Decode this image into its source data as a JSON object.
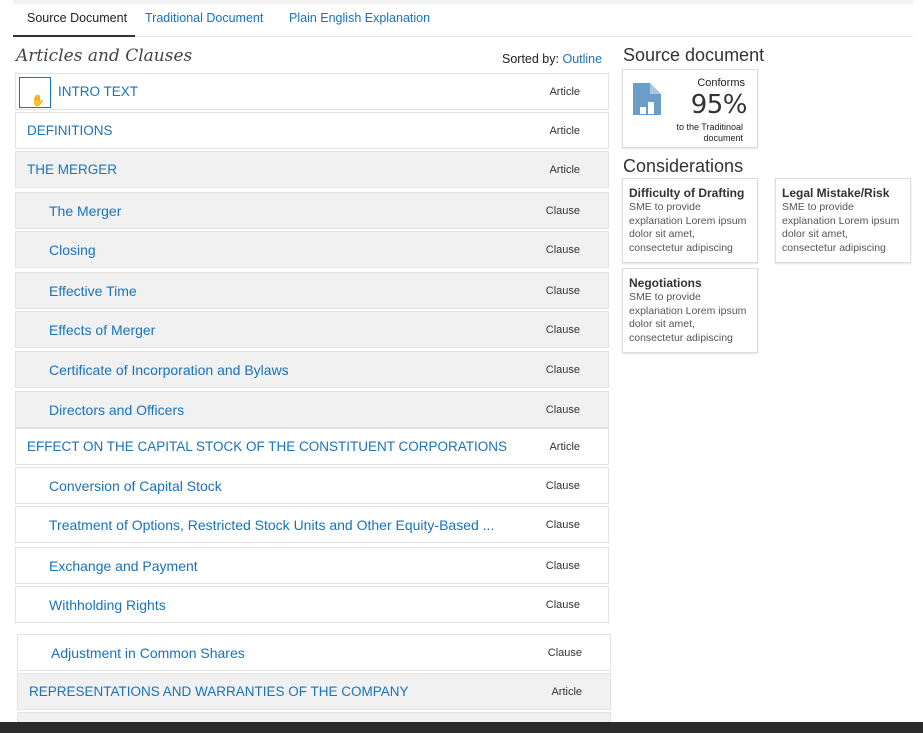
{
  "tabs": {
    "source": "Source Document",
    "traditional": "Traditional Document",
    "plain": "Plain English Explanation"
  },
  "left": {
    "title": "Articles and Clauses",
    "sorted_prefix": "Sorted by:",
    "sorted_value": "Outline"
  },
  "rows": [
    {
      "label": "INTRO TEXT",
      "kind": "Article"
    },
    {
      "label": "DEFINITIONS",
      "kind": "Article"
    },
    {
      "label": "THE MERGER",
      "kind": "Article"
    },
    {
      "label": "The Merger",
      "kind": "Clause"
    },
    {
      "label": "Closing",
      "kind": "Clause"
    },
    {
      "label": "Effective Time",
      "kind": "Clause"
    },
    {
      "label": "Effects of Merger",
      "kind": "Clause"
    },
    {
      "label": "Certificate of Incorporation and Bylaws",
      "kind": "Clause"
    },
    {
      "label": "Directors and Officers",
      "kind": "Clause"
    },
    {
      "label": "EFFECT ON THE CAPITAL STOCK OF THE CONSTITUENT CORPORATIONS",
      "kind": "Article"
    },
    {
      "label": "Conversion of Capital Stock",
      "kind": "Clause"
    },
    {
      "label": "Treatment of Options, Restricted Stock Units and Other Equity-Based ...",
      "kind": "Clause"
    },
    {
      "label": "Exchange and Payment",
      "kind": "Clause"
    },
    {
      "label": "Withholding Rights",
      "kind": "Clause"
    },
    {
      "label": "Adjustment in Common Shares",
      "kind": "Clause"
    },
    {
      "label": "REPRESENTATIONS AND WARRANTIES OF THE COMPANY",
      "kind": "Article"
    }
  ],
  "right": {
    "source_title": "Source document",
    "conforms_label": "Conforms",
    "conforms_value": "95%",
    "conforms_sub": "to the Traditinoal document",
    "considerations_title": "Considerations",
    "cards": [
      {
        "title": "Difficulty of Drafting",
        "text": "SME to provide explanation Lorem ipsum dolor sit amet, consectetur adipiscing"
      },
      {
        "title": "Legal Mistake/Risk",
        "text": "SME to provide explanation Lorem ipsum dolor sit amet, consectetur adipiscing"
      },
      {
        "title": "Negotiations",
        "text": "SME to provide explanation Lorem ipsum dolor sit amet, consectetur adipiscing"
      }
    ]
  },
  "colors": {
    "link": "#1a73b8",
    "row_grey": "#f1f1f1",
    "icon_blue": "#6a9ec7"
  }
}
